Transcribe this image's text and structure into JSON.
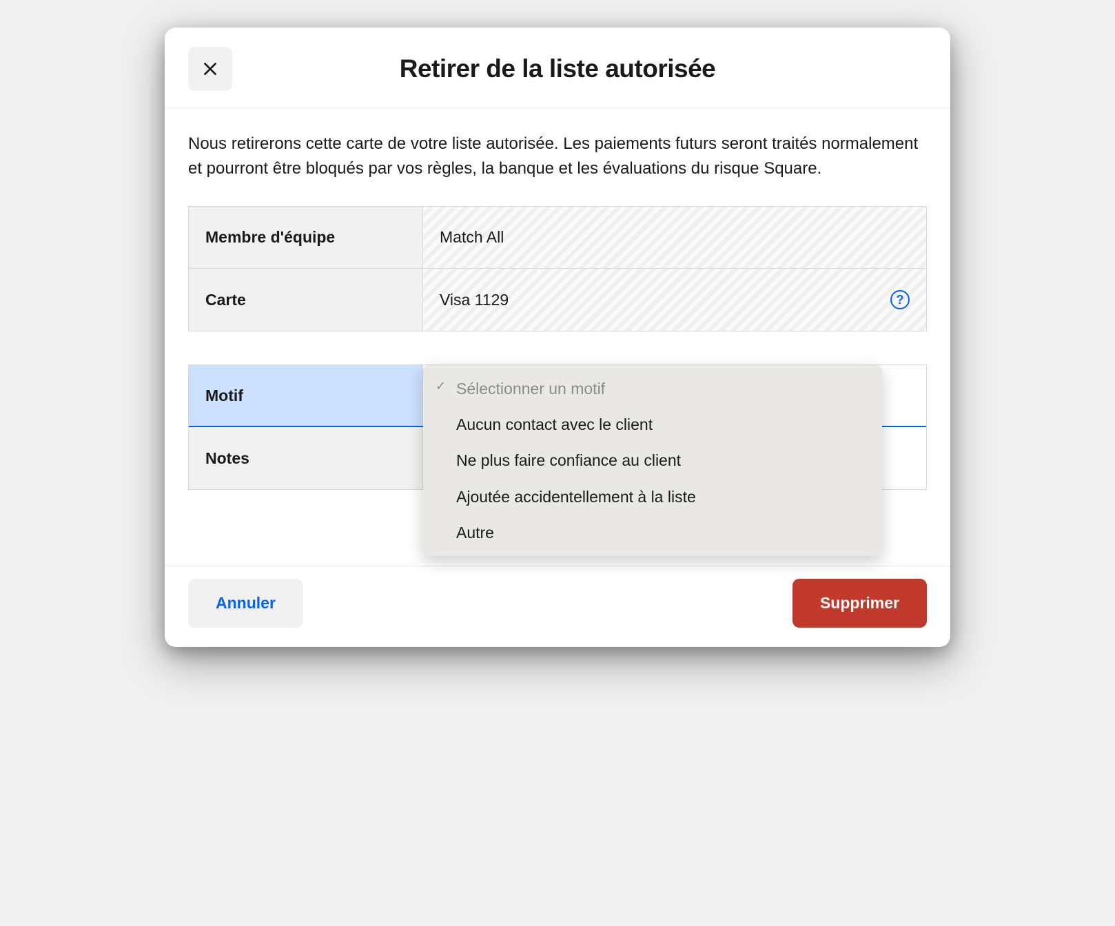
{
  "modal": {
    "title": "Retirer de la liste autorisée",
    "description": "Nous retirerons cette carte de votre liste autorisée. Les paiements futurs seront traités normalement et pourront être bloqués par vos règles, la banque et les évaluations du risque Square."
  },
  "info": {
    "team_member_label": "Membre d'équipe",
    "team_member_value": "Match All",
    "card_label": "Carte",
    "card_value": "Visa 1129"
  },
  "form": {
    "reason_label": "Motif",
    "notes_label": "Notes",
    "reason_dropdown": {
      "placeholder": "Sélectionner un motif",
      "options": [
        "Aucun contact avec le client",
        "Ne plus faire confiance au client",
        "Ajoutée accidentellement à la liste",
        "Autre"
      ]
    }
  },
  "footer": {
    "cancel_label": "Annuler",
    "delete_label": "Supprimer"
  },
  "help_glyph": "?"
}
